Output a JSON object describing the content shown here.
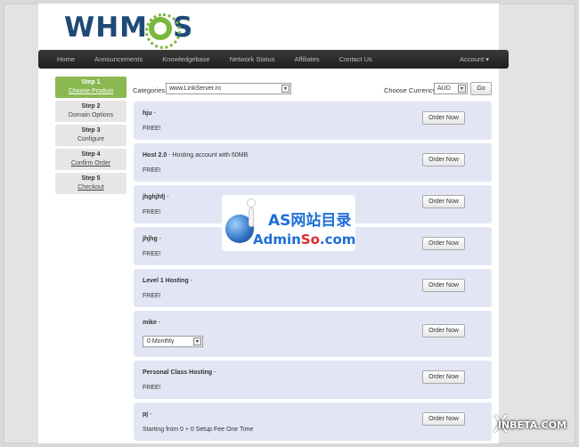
{
  "logo": {
    "text_left": "WHM",
    "text_right": "S"
  },
  "nav": {
    "items": [
      "Home",
      "Announcements",
      "Knowledgebase",
      "Network Status",
      "Affiliates",
      "Contact Us"
    ],
    "account": "Account ▾"
  },
  "steps": [
    {
      "num": "Step 1",
      "label": "Choose Product",
      "active": true
    },
    {
      "num": "Step 2",
      "label": "Domain Options"
    },
    {
      "num": "Step 3",
      "label": "Configure"
    },
    {
      "num": "Step 4",
      "label": "Confirm Order"
    },
    {
      "num": "Step 5",
      "label": "Checkout"
    }
  ],
  "filters": {
    "categories_label": "Categories:",
    "category_value": "www.LinkServer.ro",
    "currency_label": "Choose Currency:",
    "currency_value": "AUD",
    "go_label": "Go"
  },
  "products": [
    {
      "name": "hju",
      "desc": " -",
      "price": "FREE!"
    },
    {
      "name": "Host 2.0",
      "desc": " - Hosting account with 60MB",
      "price": "FREE!"
    },
    {
      "name": "jhghjhfj",
      "desc": " -",
      "price": "FREE!"
    },
    {
      "name": "jhjhg",
      "desc": " -",
      "price": "FREE!"
    },
    {
      "name": "Level 1 Hosting",
      "desc": " -",
      "price": "FREE!"
    },
    {
      "name": "mike",
      "desc": " -",
      "billing": "0 Monthly"
    },
    {
      "name": "Personal Class Hosting",
      "desc": " -",
      "price": "FREE!"
    },
    {
      "name": "pj",
      "desc": " -",
      "price": "Starting from 0 + 0 Setup Fee One Time"
    }
  ],
  "order_label": "Order Now",
  "watermarks": {
    "admin_line1": "AS网站目录",
    "admin_line2a": "Admin",
    "admin_line2b": "So",
    "admin_line2c": ".com",
    "inbeta": "INBETA.COM",
    "inbeta_x": "X"
  }
}
